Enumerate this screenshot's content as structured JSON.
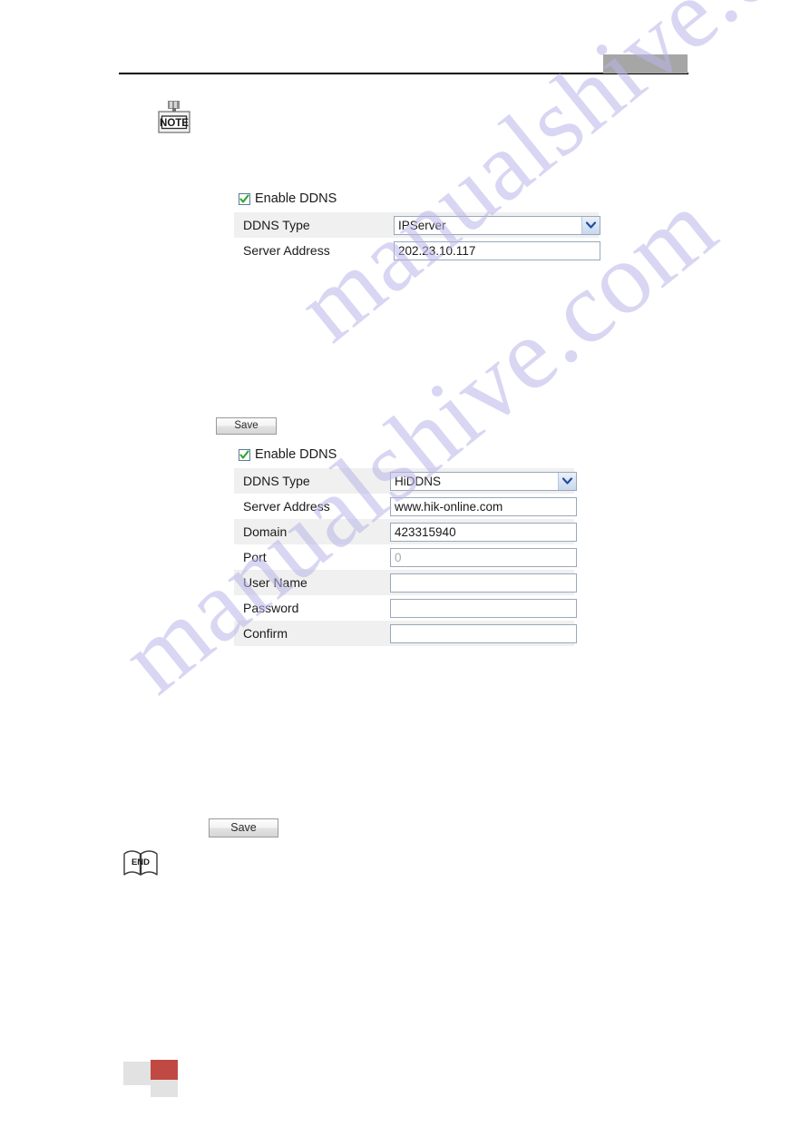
{
  "page": {
    "watermark_text": "manualshive.com",
    "note_icon_label": "NOTE",
    "end_icon_label": "END"
  },
  "header": {
    "redacted_block": "",
    "block_color": "#a6a6a6"
  },
  "form_ipserver": {
    "enable_checkbox": {
      "label": "Enable DDNS",
      "checked": true,
      "check_color": "#2aa82a"
    },
    "rows": [
      {
        "label": "DDNS Type",
        "type": "select",
        "value": "IPServer"
      },
      {
        "label": "Server Address",
        "type": "text",
        "value": "202.23.10.117"
      }
    ]
  },
  "form_hiddns": {
    "enable_checkbox": {
      "label": "Enable DDNS",
      "checked": true,
      "check_color": "#2aa82a"
    },
    "rows": [
      {
        "label": "DDNS Type",
        "type": "select",
        "value": "HiDDNS"
      },
      {
        "label": "Server Address",
        "type": "text",
        "value": "www.hik-online.com"
      },
      {
        "label": "Domain",
        "type": "text",
        "value": "423315940"
      },
      {
        "label": "Port",
        "type": "text",
        "value": "0",
        "muted": true
      },
      {
        "label": "User Name",
        "type": "text",
        "value": ""
      },
      {
        "label": "Password",
        "type": "text",
        "value": ""
      },
      {
        "label": "Confirm",
        "type": "text",
        "value": ""
      }
    ]
  },
  "buttons": {
    "save_top": "Save",
    "save_bottom": "Save"
  },
  "footer": {
    "swatch_gray": "#e2e2e2",
    "swatch_red": "#c04a43"
  }
}
